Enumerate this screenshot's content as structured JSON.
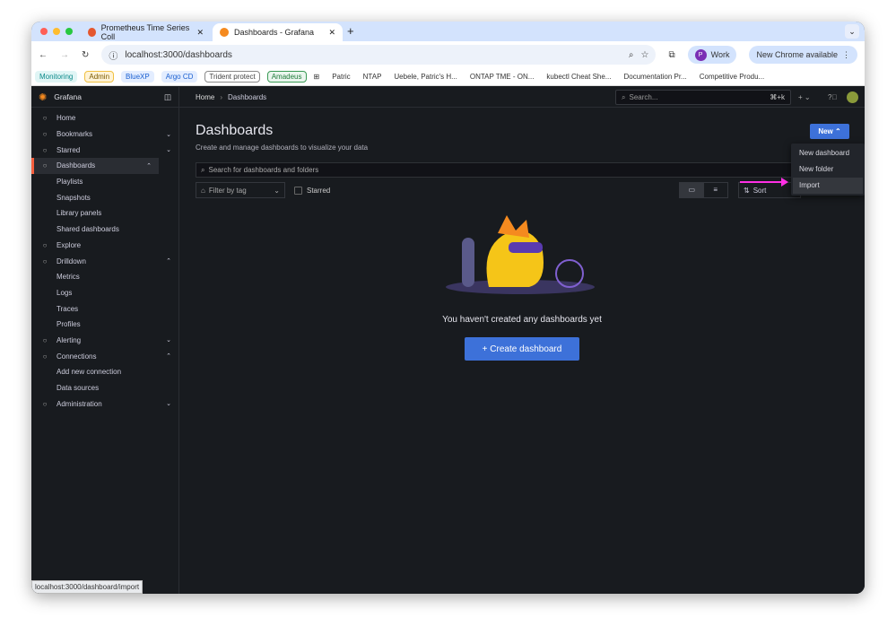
{
  "browser": {
    "tabs": [
      {
        "title": "Prometheus Time Series Coll"
      },
      {
        "title": "Dashboards - Grafana"
      }
    ],
    "url": "localhost:3000/dashboards",
    "profile": "Work",
    "profile_initial": "P",
    "update": "New Chrome available",
    "bookmarks": [
      {
        "label": "Monitoring",
        "color": "#0b8a8a",
        "bg": "#e0f5f5"
      },
      {
        "label": "Admin",
        "color": "#7a5a00",
        "bg": "#fff3d6",
        "border": "#f0c040"
      },
      {
        "label": "BlueXP",
        "color": "#1a5fd0",
        "bg": "#e3edff"
      },
      {
        "label": "Argo CD",
        "color": "#1a5fd0",
        "bg": "#e3edff"
      },
      {
        "label": "Trident protect",
        "color": "#444",
        "bg": "#fff",
        "border": "#888"
      },
      {
        "label": "Amadeus",
        "color": "#1e7a3a",
        "bg": "#eaf6ee",
        "border": "#3a9a55"
      }
    ],
    "links": [
      "Patric",
      "NTAP",
      "Uebele, Patric's H...",
      "ONTAP TME - ON...",
      "kubectl Cheat She...",
      "Documentation Pr...",
      "Competitive Produ..."
    ],
    "status_url": "localhost:3000/dashboard/import"
  },
  "grafana": {
    "app": "Grafana",
    "breadcrumb": [
      "Home",
      "Dashboards"
    ],
    "search_placeholder": "Search...",
    "shortcut": "⌘+k",
    "nav": [
      {
        "label": "Home",
        "icon": "home-icon"
      },
      {
        "label": "Bookmarks",
        "icon": "bookmark-icon",
        "chev": "⌄"
      },
      {
        "label": "Starred",
        "icon": "star-icon",
        "chev": "⌄"
      },
      {
        "label": "Dashboards",
        "icon": "dashboards-icon",
        "chev": "⌃",
        "active": true
      },
      {
        "label": "Playlists",
        "sub": true
      },
      {
        "label": "Snapshots",
        "sub": true
      },
      {
        "label": "Library panels",
        "sub": true
      },
      {
        "label": "Shared dashboards",
        "sub": true
      },
      {
        "label": "Explore",
        "icon": "compass-icon"
      },
      {
        "label": "Drilldown",
        "icon": "drilldown-icon",
        "chev": "⌃"
      },
      {
        "label": "Metrics",
        "sub": true
      },
      {
        "label": "Logs",
        "sub": true
      },
      {
        "label": "Traces",
        "sub": true
      },
      {
        "label": "Profiles",
        "sub": true
      },
      {
        "label": "Alerting",
        "icon": "bell-icon",
        "chev": "⌄"
      },
      {
        "label": "Connections",
        "icon": "connections-icon",
        "chev": "⌃"
      },
      {
        "label": "Add new connection",
        "sub": true
      },
      {
        "label": "Data sources",
        "sub": true
      },
      {
        "label": "Administration",
        "icon": "gear-icon",
        "chev": "⌄"
      }
    ],
    "title": "Dashboards",
    "subtitle": "Create and manage dashboards to visualize your data",
    "new_label": "New ⌃",
    "new_menu": [
      "New dashboard",
      "New folder",
      "Import"
    ],
    "search_dash_placeholder": "Search for dashboards and folders",
    "filter_tag": "Filter by tag",
    "starred": "Starred",
    "sort": "Sort",
    "empty_text": "You haven't created any dashboards yet",
    "create_label": "+  Create dashboard",
    "accent": "#3d71d9"
  }
}
